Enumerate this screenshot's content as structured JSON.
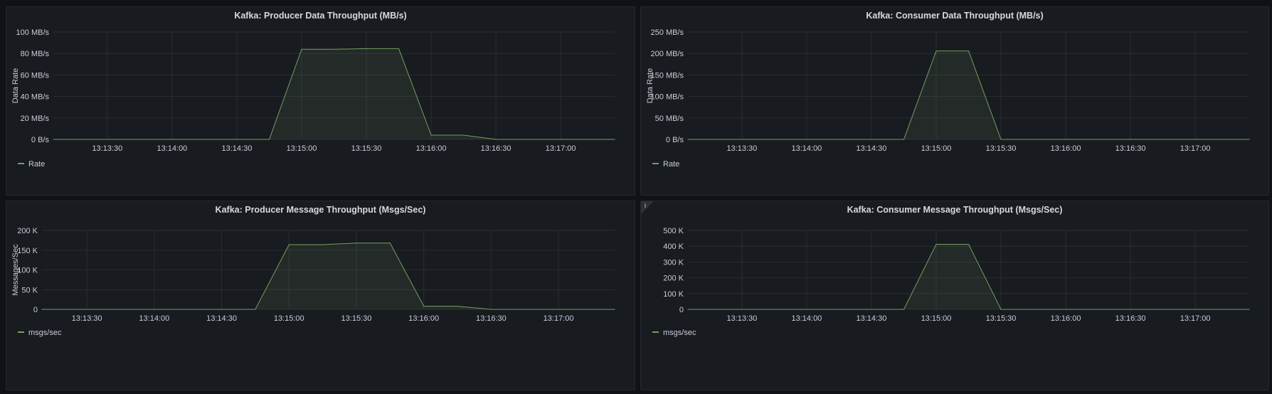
{
  "colors": {
    "series": "#73a062",
    "fill": "rgba(115,160,98,0.12)",
    "grid": "#2b2d33",
    "text": "#ccccdc"
  },
  "panels": [
    {
      "title": "Kafka: Producer Data Throughput (MB/s)",
      "legend": "Rate"
    },
    {
      "title": "Kafka: Consumer Data Throughput (MB/s)",
      "legend": "Rate"
    },
    {
      "title": "Kafka: Producer Message Throughput (Msgs/Sec)",
      "legend": "msgs/sec"
    },
    {
      "title": "Kafka: Consumer Message Throughput (Msgs/Sec)",
      "legend": "msgs/sec",
      "info_icon": "i"
    }
  ],
  "chart_data": [
    {
      "type": "area",
      "title": "Kafka: Producer Data Throughput (MB/s)",
      "ylabel": "Data Rate",
      "xlim": [
        "13:13:05",
        "13:17:25"
      ],
      "ylim": [
        0,
        100
      ],
      "x_ticks": [
        "13:13:30",
        "13:14:00",
        "13:14:30",
        "13:15:00",
        "13:15:30",
        "13:16:00",
        "13:16:30",
        "13:17:00"
      ],
      "y_ticks": [
        0,
        20,
        40,
        60,
        80,
        100
      ],
      "y_tick_labels": [
        "0 B/s",
        "20 MB/s",
        "40 MB/s",
        "60 MB/s",
        "80 MB/s",
        "100 MB/s"
      ],
      "legend_position": "bottom-left",
      "grid": true,
      "series": [
        {
          "name": "Rate",
          "x": [
            "13:13:05",
            "13:14:45",
            "13:15:00",
            "13:15:15",
            "13:15:30",
            "13:15:45",
            "13:16:00",
            "13:16:15",
            "13:16:30",
            "13:16:45",
            "13:17:00",
            "13:17:25"
          ],
          "values": [
            0,
            0,
            84,
            84,
            84.5,
            84.5,
            4,
            4,
            0,
            0,
            0,
            0
          ]
        }
      ]
    },
    {
      "type": "area",
      "title": "Kafka: Consumer Data Throughput (MB/s)",
      "ylabel": "Data Rate",
      "xlim": [
        "13:13:05",
        "13:17:25"
      ],
      "ylim": [
        0,
        250
      ],
      "x_ticks": [
        "13:13:30",
        "13:14:00",
        "13:14:30",
        "13:15:00",
        "13:15:30",
        "13:16:00",
        "13:16:30",
        "13:17:00"
      ],
      "y_ticks": [
        0,
        50,
        100,
        150,
        200,
        250
      ],
      "y_tick_labels": [
        "0 B/s",
        "50 MB/s",
        "100 MB/s",
        "150 MB/s",
        "200 MB/s",
        "250 MB/s"
      ],
      "legend_position": "bottom-left",
      "grid": true,
      "series": [
        {
          "name": "Rate",
          "x": [
            "13:13:05",
            "13:14:45",
            "13:15:00",
            "13:15:15",
            "13:15:30",
            "13:15:45",
            "13:16:00",
            "13:16:30",
            "13:17:00",
            "13:17:25"
          ],
          "values": [
            0,
            0,
            206,
            206,
            0,
            0,
            0,
            0,
            0,
            0
          ]
        }
      ]
    },
    {
      "type": "area",
      "title": "Kafka: Producer Message Throughput (Msgs/Sec)",
      "ylabel": "Messages/Sec",
      "xlim": [
        "13:13:10",
        "13:17:25"
      ],
      "ylim": [
        0,
        200000
      ],
      "x_ticks": [
        "13:13:30",
        "13:14:00",
        "13:14:30",
        "13:15:00",
        "13:15:30",
        "13:16:00",
        "13:16:30",
        "13:17:00"
      ],
      "y_ticks": [
        0,
        50000,
        100000,
        150000,
        200000
      ],
      "y_tick_labels": [
        "0",
        "50 K",
        "100 K",
        "150 K",
        "200 K"
      ],
      "legend_position": "bottom-left",
      "grid": true,
      "series": [
        {
          "name": "msgs/sec",
          "x": [
            "13:13:10",
            "13:14:45",
            "13:15:00",
            "13:15:15",
            "13:15:30",
            "13:15:45",
            "13:16:00",
            "13:16:15",
            "13:16:30",
            "13:16:45",
            "13:17:00",
            "13:17:25"
          ],
          "values": [
            0,
            0,
            164000,
            164000,
            168000,
            168000,
            8000,
            8000,
            0,
            0,
            0,
            0
          ]
        }
      ]
    },
    {
      "type": "area",
      "title": "Kafka: Consumer Message Throughput (Msgs/Sec)",
      "ylabel": "",
      "xlim": [
        "13:13:05",
        "13:17:25"
      ],
      "ylim": [
        0,
        500000
      ],
      "x_ticks": [
        "13:13:30",
        "13:14:00",
        "13:14:30",
        "13:15:00",
        "13:15:30",
        "13:16:00",
        "13:16:30",
        "13:17:00"
      ],
      "y_ticks": [
        0,
        100000,
        200000,
        300000,
        400000,
        500000
      ],
      "y_tick_labels": [
        "0",
        "100 K",
        "200 K",
        "300 K",
        "400 K",
        "500 K"
      ],
      "legend_position": "bottom-left",
      "grid": true,
      "series": [
        {
          "name": "msgs/sec",
          "x": [
            "13:13:05",
            "13:14:45",
            "13:15:00",
            "13:15:15",
            "13:15:30",
            "13:15:45",
            "13:16:00",
            "13:16:30",
            "13:17:00",
            "13:17:25"
          ],
          "values": [
            0,
            0,
            412000,
            412000,
            0,
            0,
            0,
            0,
            0,
            0
          ]
        }
      ]
    }
  ]
}
